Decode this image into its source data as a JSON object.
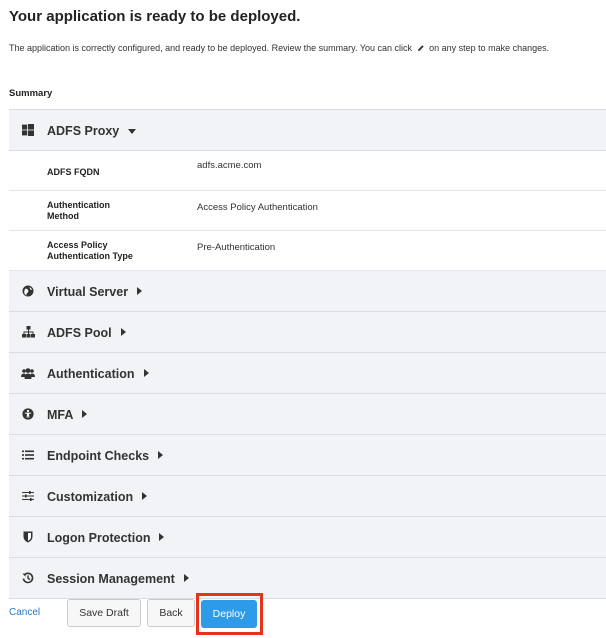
{
  "header": {
    "title": "Your application is ready to be deployed.",
    "intro_before": "The application is correctly configured, and ready to be deployed. Review the summary. You can click",
    "intro_after": "on any step to make changes."
  },
  "summary": {
    "label": "Summary",
    "adfs_proxy": {
      "title": "ADFS Proxy",
      "icon": "windows-icon",
      "expanded": true,
      "details": [
        {
          "key": "ADFS FQDN",
          "value": "adfs.acme.com"
        },
        {
          "key": "Authentication Method",
          "value": "Access Policy Authentication"
        },
        {
          "key": "Access Policy Authentication Type",
          "value": "Pre-Authentication"
        }
      ]
    },
    "sections": [
      {
        "title": "Virtual Server",
        "icon": "globe-icon"
      },
      {
        "title": "ADFS Pool",
        "icon": "sitemap-icon"
      },
      {
        "title": "Authentication",
        "icon": "users-icon"
      },
      {
        "title": "MFA",
        "icon": "universal-access-icon"
      },
      {
        "title": "Endpoint Checks",
        "icon": "list-icon"
      },
      {
        "title": "Customization",
        "icon": "sliders-icon"
      },
      {
        "title": "Logon Protection",
        "icon": "shield-icon"
      },
      {
        "title": "Session Management",
        "icon": "history-icon"
      }
    ]
  },
  "footer": {
    "cancel": "Cancel",
    "save_draft": "Save Draft",
    "back": "Back",
    "deploy": "Deploy"
  },
  "colors": {
    "accent": "#2e9bea",
    "highlight": "#e8321c",
    "link": "#2a78c2",
    "section_bg": "#f1f3f6"
  }
}
